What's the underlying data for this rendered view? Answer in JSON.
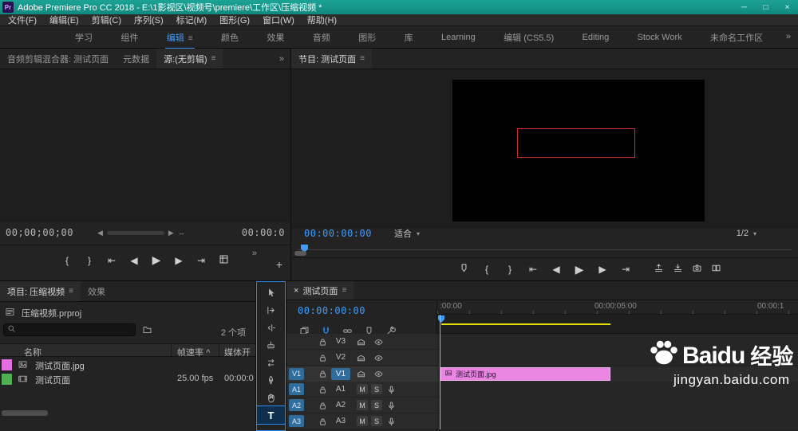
{
  "colors": {
    "accent": "#2d8ceb",
    "timecode_blue": "#3f9bfa",
    "titlebar_teal": "#15988c",
    "clip_pink": "#ea85e2",
    "swatch_pink": "#e26ee0",
    "swatch_green": "#4fb052",
    "render_bar_yellow": "#e2e20a",
    "overlay_red": "#cf2b2b"
  },
  "window": {
    "app_badge": "Pr",
    "title": "Adobe Premiere Pro CC 2018 - E:\\1影视区\\视频号\\premiere\\工作区\\压缩视频 *"
  },
  "menu": {
    "items": [
      "文件(F)",
      "编辑(E)",
      "剪辑(C)",
      "序列(S)",
      "标记(M)",
      "图形(G)",
      "窗口(W)",
      "帮助(H)"
    ]
  },
  "workspaces": {
    "items": [
      {
        "label": "学习"
      },
      {
        "label": "组件"
      },
      {
        "label": "编辑"
      },
      {
        "label": "颜色"
      },
      {
        "label": "效果"
      },
      {
        "label": "音频"
      },
      {
        "label": "图形"
      },
      {
        "label": "库"
      },
      {
        "label": "Learning"
      },
      {
        "label": "编辑 (CS5.5)"
      },
      {
        "label": "Editing"
      },
      {
        "label": "Stock Work"
      },
      {
        "label": "未命名工作区"
      }
    ]
  },
  "source": {
    "tabs": [
      {
        "label": "音频剪辑混合器: 测试页面"
      },
      {
        "label": "元数据"
      },
      {
        "label": "源:(无剪辑)"
      }
    ],
    "timecode": "00;00;00;00",
    "duration": "00:00:0"
  },
  "program": {
    "tab": "节目: 测试页面",
    "timecode": "00:00:00:00",
    "fit": "适合",
    "resolution": "1/2"
  },
  "project": {
    "tabs": [
      {
        "label": "项目: 压缩视频"
      },
      {
        "label": "效果"
      }
    ],
    "file_name": "压缩视频.prproj",
    "item_count": "2 个项",
    "columns": [
      {
        "label": "名称"
      },
      {
        "label": "帧速率"
      },
      {
        "label": "媒体开"
      }
    ],
    "rows": [
      {
        "name": "测试页面.jpg",
        "framerate": "",
        "media_start": "",
        "swatch": "#e26ee0"
      },
      {
        "name": "测试页面",
        "framerate": "25.00 fps",
        "media_start": "00:00:0",
        "swatch": "#4fb052"
      }
    ]
  },
  "tools": {
    "items": [
      "selection",
      "track-select-forward",
      "ripple-edit",
      "razor",
      "slip",
      "pen",
      "hand",
      "type"
    ]
  },
  "timeline": {
    "tab": "测试页面",
    "timecode": "00:00:00:00",
    "ruler": [
      ":00:00",
      "00:00:05:00",
      "00:00:1"
    ],
    "video_tracks": [
      {
        "name": "V3",
        "patch": ""
      },
      {
        "name": "V2",
        "patch": ""
      },
      {
        "name": "V1",
        "patch": "V1"
      }
    ],
    "audio_tracks": [
      {
        "name": "A1",
        "patch": "A1"
      },
      {
        "name": "A2",
        "patch": "A2"
      },
      {
        "name": "A3",
        "patch": "A3"
      }
    ],
    "clip_label": "测试页面.jpg"
  },
  "watermark": {
    "brand_en": "Baidu",
    "brand_cn": "经验",
    "url": "jingyan.baidu.com"
  },
  "glyphs": {
    "menu": "≡",
    "overflow": "»",
    "dropdown": "▾",
    "minimize": "─",
    "maximize": "□",
    "close": "×",
    "tab_close": "×",
    "mark_in": "{",
    "mark_out": "}",
    "go_to_in": "⇤",
    "go_to_out": "⇥",
    "step_back": "◀",
    "play": "▶",
    "step_forward": "▶",
    "add_button": "+",
    "sort_asc": "^",
    "nav_left": "◀",
    "nav_right": "▶",
    "resize": "↔",
    "mute": "M",
    "solo": "S",
    "type_tool": "T"
  }
}
